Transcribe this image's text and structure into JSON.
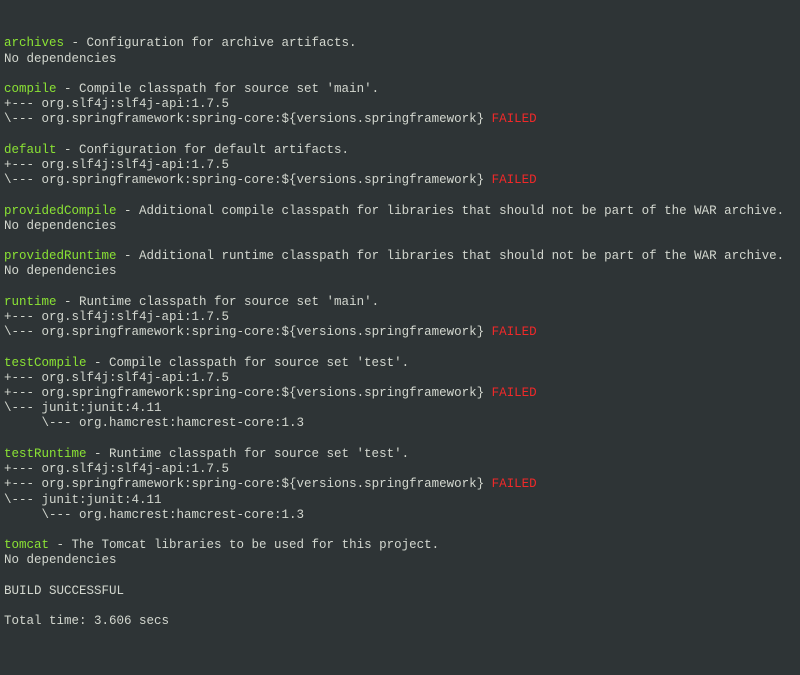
{
  "configs": [
    {
      "name": "archives",
      "desc": " - Configuration for archive artifacts.",
      "deps": [],
      "nodeps": true
    },
    {
      "name": "compile",
      "desc": " - Compile classpath for source set 'main'.",
      "deps": [
        {
          "prefix": "+--- ",
          "text": "org.slf4j:slf4j-api:1.7.5",
          "failed": false
        },
        {
          "prefix": "\\--- ",
          "text": "org.springframework:spring-core:${versions.springframework} ",
          "failed": true
        }
      ],
      "nodeps": false
    },
    {
      "name": "default",
      "desc": " - Configuration for default artifacts.",
      "deps": [
        {
          "prefix": "+--- ",
          "text": "org.slf4j:slf4j-api:1.7.5",
          "failed": false
        },
        {
          "prefix": "\\--- ",
          "text": "org.springframework:spring-core:${versions.springframework} ",
          "failed": true
        }
      ],
      "nodeps": false
    },
    {
      "name": "providedCompile",
      "desc": " - Additional compile classpath for libraries that should not be part of the WAR archive.",
      "deps": [],
      "nodeps": true
    },
    {
      "name": "providedRuntime",
      "desc": " - Additional runtime classpath for libraries that should not be part of the WAR archive.",
      "deps": [],
      "nodeps": true
    },
    {
      "name": "runtime",
      "desc": " - Runtime classpath for source set 'main'.",
      "deps": [
        {
          "prefix": "+--- ",
          "text": "org.slf4j:slf4j-api:1.7.5",
          "failed": false
        },
        {
          "prefix": "\\--- ",
          "text": "org.springframework:spring-core:${versions.springframework} ",
          "failed": true
        }
      ],
      "nodeps": false
    },
    {
      "name": "testCompile",
      "desc": " - Compile classpath for source set 'test'.",
      "deps": [
        {
          "prefix": "+--- ",
          "text": "org.slf4j:slf4j-api:1.7.5",
          "failed": false
        },
        {
          "prefix": "+--- ",
          "text": "org.springframework:spring-core:${versions.springframework} ",
          "failed": true
        },
        {
          "prefix": "\\--- ",
          "text": "junit:junit:4.11",
          "failed": false
        },
        {
          "prefix": "     \\--- ",
          "text": "org.hamcrest:hamcrest-core:1.3",
          "failed": false
        }
      ],
      "nodeps": false
    },
    {
      "name": "testRuntime",
      "desc": " - Runtime classpath for source set 'test'.",
      "deps": [
        {
          "prefix": "+--- ",
          "text": "org.slf4j:slf4j-api:1.7.5",
          "failed": false
        },
        {
          "prefix": "+--- ",
          "text": "org.springframework:spring-core:${versions.springframework} ",
          "failed": true
        },
        {
          "prefix": "\\--- ",
          "text": "junit:junit:4.11",
          "failed": false
        },
        {
          "prefix": "     \\--- ",
          "text": "org.hamcrest:hamcrest-core:1.3",
          "failed": false
        }
      ],
      "nodeps": false
    },
    {
      "name": "tomcat",
      "desc": " - The Tomcat libraries to be used for this project.",
      "deps": [],
      "nodeps": true
    }
  ],
  "strings": {
    "nodeps": "No dependencies",
    "failed": "FAILED",
    "build_successful": "BUILD SUCCESSFUL",
    "total_time": "Total time: 3.606 secs"
  }
}
